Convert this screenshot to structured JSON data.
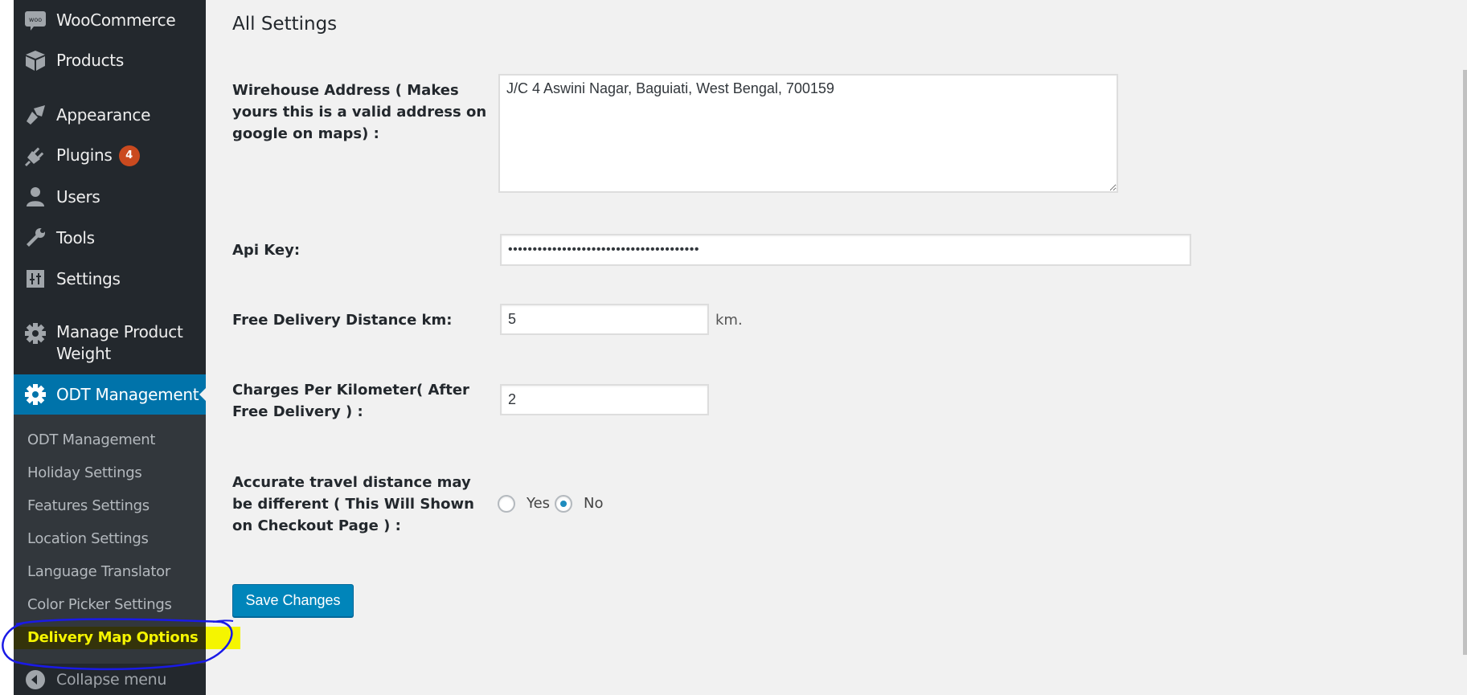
{
  "sidebar": {
    "items": [
      {
        "label": "WooCommerce",
        "icon": "woocommerce-icon"
      },
      {
        "label": "Products",
        "icon": "box-icon"
      },
      {
        "label": "Appearance",
        "icon": "paintbrush-icon"
      },
      {
        "label": "Plugins",
        "icon": "plug-icon",
        "badge": "4"
      },
      {
        "label": "Users",
        "icon": "user-icon"
      },
      {
        "label": "Tools",
        "icon": "wrench-icon"
      },
      {
        "label": "Settings",
        "icon": "sliders-icon"
      },
      {
        "label_line1": "Manage Product",
        "label_line2": "Weight",
        "icon": "gear-icon"
      }
    ],
    "active": {
      "label": "ODT Management",
      "icon": "gear-icon"
    },
    "submenu": [
      {
        "label": "ODT Management"
      },
      {
        "label": "Holiday Settings"
      },
      {
        "label": "Features Settings"
      },
      {
        "label": "Location Settings"
      },
      {
        "label": "Language Translator"
      },
      {
        "label": "Color Picker Settings"
      },
      {
        "label": "Delivery Map Options",
        "current": true
      }
    ],
    "collapse_label": "Collapse menu"
  },
  "main": {
    "title": "All Settings",
    "fields": {
      "address": {
        "label_lines": [
          "Wirehouse Address ( Makes",
          "yours this is a valid address on",
          "google on maps) :"
        ],
        "value": "J/C 4 Aswini Nagar, Baguiati, West Bengal, 700159"
      },
      "api_key": {
        "label": "Api Key:",
        "value": "•••••••••••••••••••••••••••••••••••••••"
      },
      "free_distance": {
        "label": "Free Delivery Distance km:",
        "value": "5",
        "unit": "km."
      },
      "charges": {
        "label_lines": [
          "Charges Per Kilometer( After",
          "Free Delivery ) :"
        ],
        "value": "2"
      },
      "accurate_distance": {
        "label_lines": [
          "Accurate travel distance may",
          "be different ( This Will Shown",
          "on Checkout Page ) :"
        ],
        "options": [
          {
            "label": "Yes",
            "checked": false
          },
          {
            "label": "No",
            "checked": true
          }
        ]
      }
    },
    "save_label": "Save Changes"
  },
  "colors": {
    "sidebar_bg": "#23282d",
    "submenu_bg": "#32373c",
    "active_bg": "#0073aa",
    "button_bg": "#0085ba",
    "badge_bg": "#ca4a1f",
    "annotation_highlight": "#f5f500",
    "annotation_circle": "#1a1ae6"
  }
}
